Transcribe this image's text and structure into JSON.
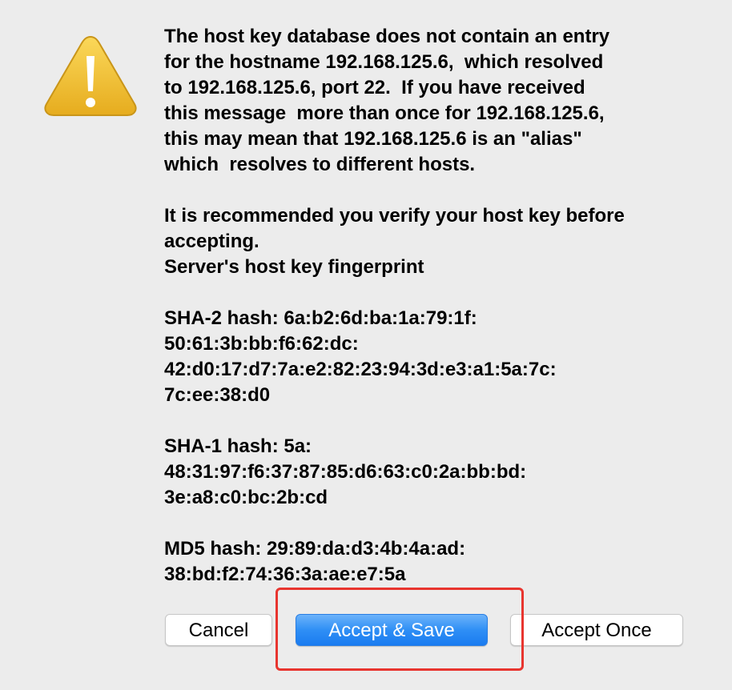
{
  "dialog": {
    "icon": "warning-triangle-icon",
    "message_lines": [
      "The host key database does not contain an entry",
      "for the hostname 192.168.125.6,  which resolved",
      "to 192.168.125.6, port 22.  If you have received",
      "this message  more than once for 192.168.125.6,",
      "this may mean that 192.168.125.6 is an \"alias\"",
      "which  resolves to different hosts.",
      "",
      "It is recommended you verify your host key before",
      "accepting.",
      "Server's host key fingerprint",
      "",
      "SHA-2 hash: 6a:b2:6d:ba:1a:79:1f:",
      "50:61:3b:bb:f6:62:dc:",
      "42:d0:17:d7:7a:e2:82:23:94:3d:e3:a1:5a:7c:",
      "7c:ee:38:d0",
      "",
      "SHA-1 hash: 5a:",
      "48:31:97:f6:37:87:85:d6:63:c0:2a:bb:bd:",
      "3e:a8:c0:bc:2b:cd",
      "",
      "MD5 hash: 29:89:da:d3:4b:4a:ad:",
      "38:bd:f2:74:36:3a:ae:e7:5a"
    ]
  },
  "buttons": {
    "cancel_label": "Cancel",
    "accept_save_label": "Accept & Save",
    "accept_once_label": "Accept Once"
  },
  "colors": {
    "background": "#ececec",
    "primary_button": "#2f8ff5",
    "highlight_box": "#e8352f",
    "warning_icon": "#f2c431"
  }
}
